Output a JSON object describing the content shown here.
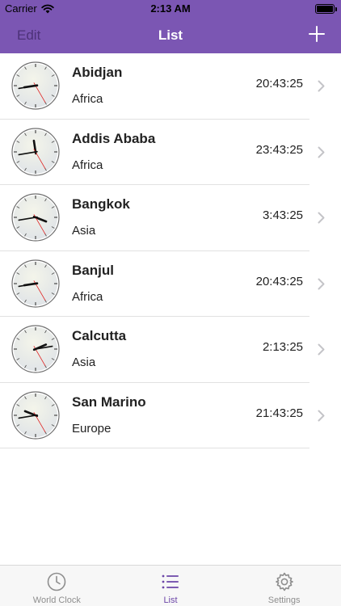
{
  "status": {
    "carrier": "Carrier",
    "time": "2:13 AM"
  },
  "nav": {
    "edit_label": "Edit",
    "title": "List",
    "add_icon": "plus-icon"
  },
  "colors": {
    "accent": "#7b56b3",
    "tab_active": "#6c46a8",
    "tab_inactive": "#8e8e8e"
  },
  "rows": [
    {
      "city": "Abidjan",
      "region": "Africa",
      "time": "20:43:25",
      "hours": 20,
      "minutes": 43,
      "seconds": 25
    },
    {
      "city": "Addis Ababa",
      "region": "Africa",
      "time": "23:43:25",
      "hours": 23,
      "minutes": 43,
      "seconds": 25
    },
    {
      "city": "Bangkok",
      "region": "Asia",
      "time": "3:43:25",
      "hours": 3,
      "minutes": 43,
      "seconds": 25
    },
    {
      "city": "Banjul",
      "region": "Africa",
      "time": "20:43:25",
      "hours": 20,
      "minutes": 43,
      "seconds": 25
    },
    {
      "city": "Calcutta",
      "region": "Asia",
      "time": "2:13:25",
      "hours": 2,
      "minutes": 13,
      "seconds": 25
    },
    {
      "city": "San Marino",
      "region": "Europe",
      "time": "21:43:25",
      "hours": 21,
      "minutes": 43,
      "seconds": 25
    }
  ],
  "tabs": [
    {
      "label": "World Clock",
      "icon": "clock-icon",
      "active": false
    },
    {
      "label": "List",
      "icon": "list-icon",
      "active": true
    },
    {
      "label": "Settings",
      "icon": "gear-icon",
      "active": false
    }
  ]
}
